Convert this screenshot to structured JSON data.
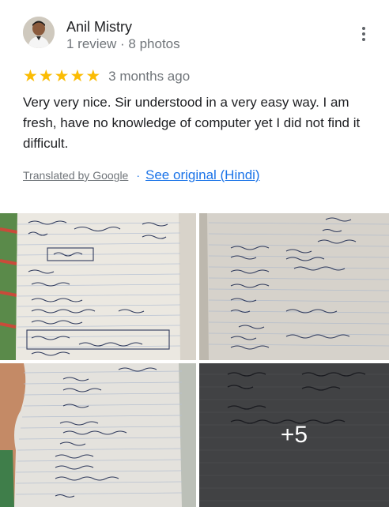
{
  "review": {
    "author_name": "Anil Mistry",
    "author_meta": "1 review · 8 photos",
    "star_rating": 5,
    "stars": [
      "★",
      "★",
      "★",
      "★",
      "★"
    ],
    "date": "3 months ago",
    "text": "Very very nice. Sir understood in a very easy way. I am fresh, have no knowledge of computer yet I did not find it difficult.",
    "translated_label": "Translated by Google",
    "separator": "·",
    "see_original_label": "See original (Hindi)"
  },
  "photos": {
    "more_count": "+5"
  },
  "colors": {
    "star": "#fbbc04",
    "link": "#1a73e8",
    "secondary_text": "#70757a",
    "primary_text": "#202124"
  },
  "icons": {
    "menu": "more-vertical-icon",
    "star": "star-icon"
  }
}
